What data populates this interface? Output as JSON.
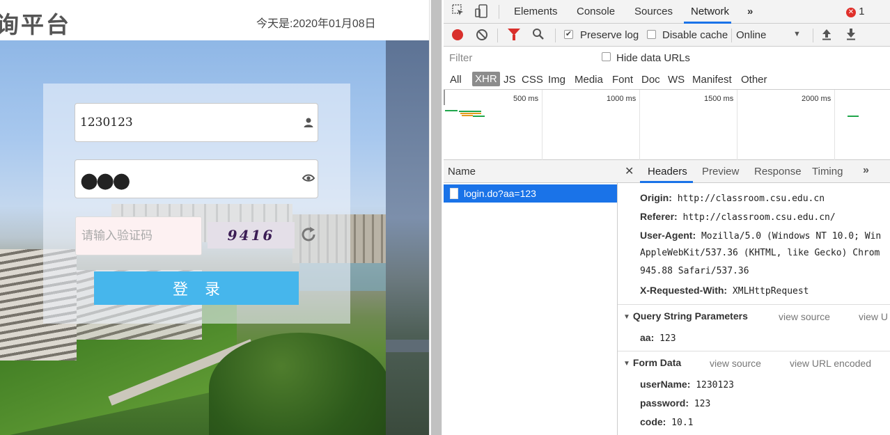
{
  "page": {
    "title": "询平台",
    "date": "今天是:2020年01月08日"
  },
  "login": {
    "username": "1230123",
    "password_mask": "●●●",
    "captcha_placeholder": "请输入验证码",
    "captcha_code": "9416",
    "button_label": "登录"
  },
  "devtools": {
    "tabs": [
      "Elements",
      "Console",
      "Sources",
      "Network"
    ],
    "active_tab": "Network",
    "more_tabs": "»",
    "error_count": "1",
    "error_icon": "✕",
    "toolbar": {
      "preserve_log": "Preserve log",
      "preserve_log_checked": true,
      "disable_cache": "Disable cache",
      "disable_cache_checked": false,
      "throttling": "Online"
    },
    "filter": {
      "placeholder": "Filter",
      "hide_data_urls": "Hide data URLs",
      "types": [
        "All",
        "XHR",
        "JS",
        "CSS",
        "Img",
        "Media",
        "Font",
        "Doc",
        "WS",
        "Manifest",
        "Other"
      ],
      "active_type": "XHR"
    },
    "timeline": {
      "labels": [
        "500 ms",
        "1000 ms",
        "1500 ms",
        "2000 ms"
      ]
    },
    "requests": {
      "column": "Name",
      "items": [
        "login.do?aa=123"
      ],
      "selected": "login.do?aa=123"
    },
    "detail": {
      "tabs": [
        "Headers",
        "Preview",
        "Response",
        "Timing"
      ],
      "active_tab": "Headers",
      "close": "✕",
      "more": "»",
      "request_headers": [
        {
          "key": "Origin:",
          "value": "http://classroom.csu.edu.cn"
        },
        {
          "key": "Referer:",
          "value": "http://classroom.csu.edu.cn/"
        },
        {
          "key": "User-Agent:",
          "value": "Mozilla/5.0 (Windows NT 10.0; Win"
        },
        {
          "key": "",
          "value": "AppleWebKit/537.36 (KHTML, like Gecko) Chrom"
        },
        {
          "key": "",
          "value": "945.88 Safari/537.36"
        },
        {
          "key": "X-Requested-With:",
          "value": "XMLHttpRequest"
        }
      ],
      "query_string": {
        "title": "Query String Parameters",
        "view_source": "view source",
        "view_url": "view U",
        "params": [
          {
            "key": "aa:",
            "value": "123"
          }
        ]
      },
      "form_data": {
        "title": "Form Data",
        "view_source": "view source",
        "view_url": "view URL encoded",
        "params": [
          {
            "key": "userName:",
            "value": "1230123"
          },
          {
            "key": "password:",
            "value": "123"
          },
          {
            "key": "code:",
            "value": "10.1"
          }
        ]
      }
    }
  },
  "colors": {
    "accent": "#1a73e8",
    "login_button": "#46b6ec",
    "record": "#d9302c"
  }
}
